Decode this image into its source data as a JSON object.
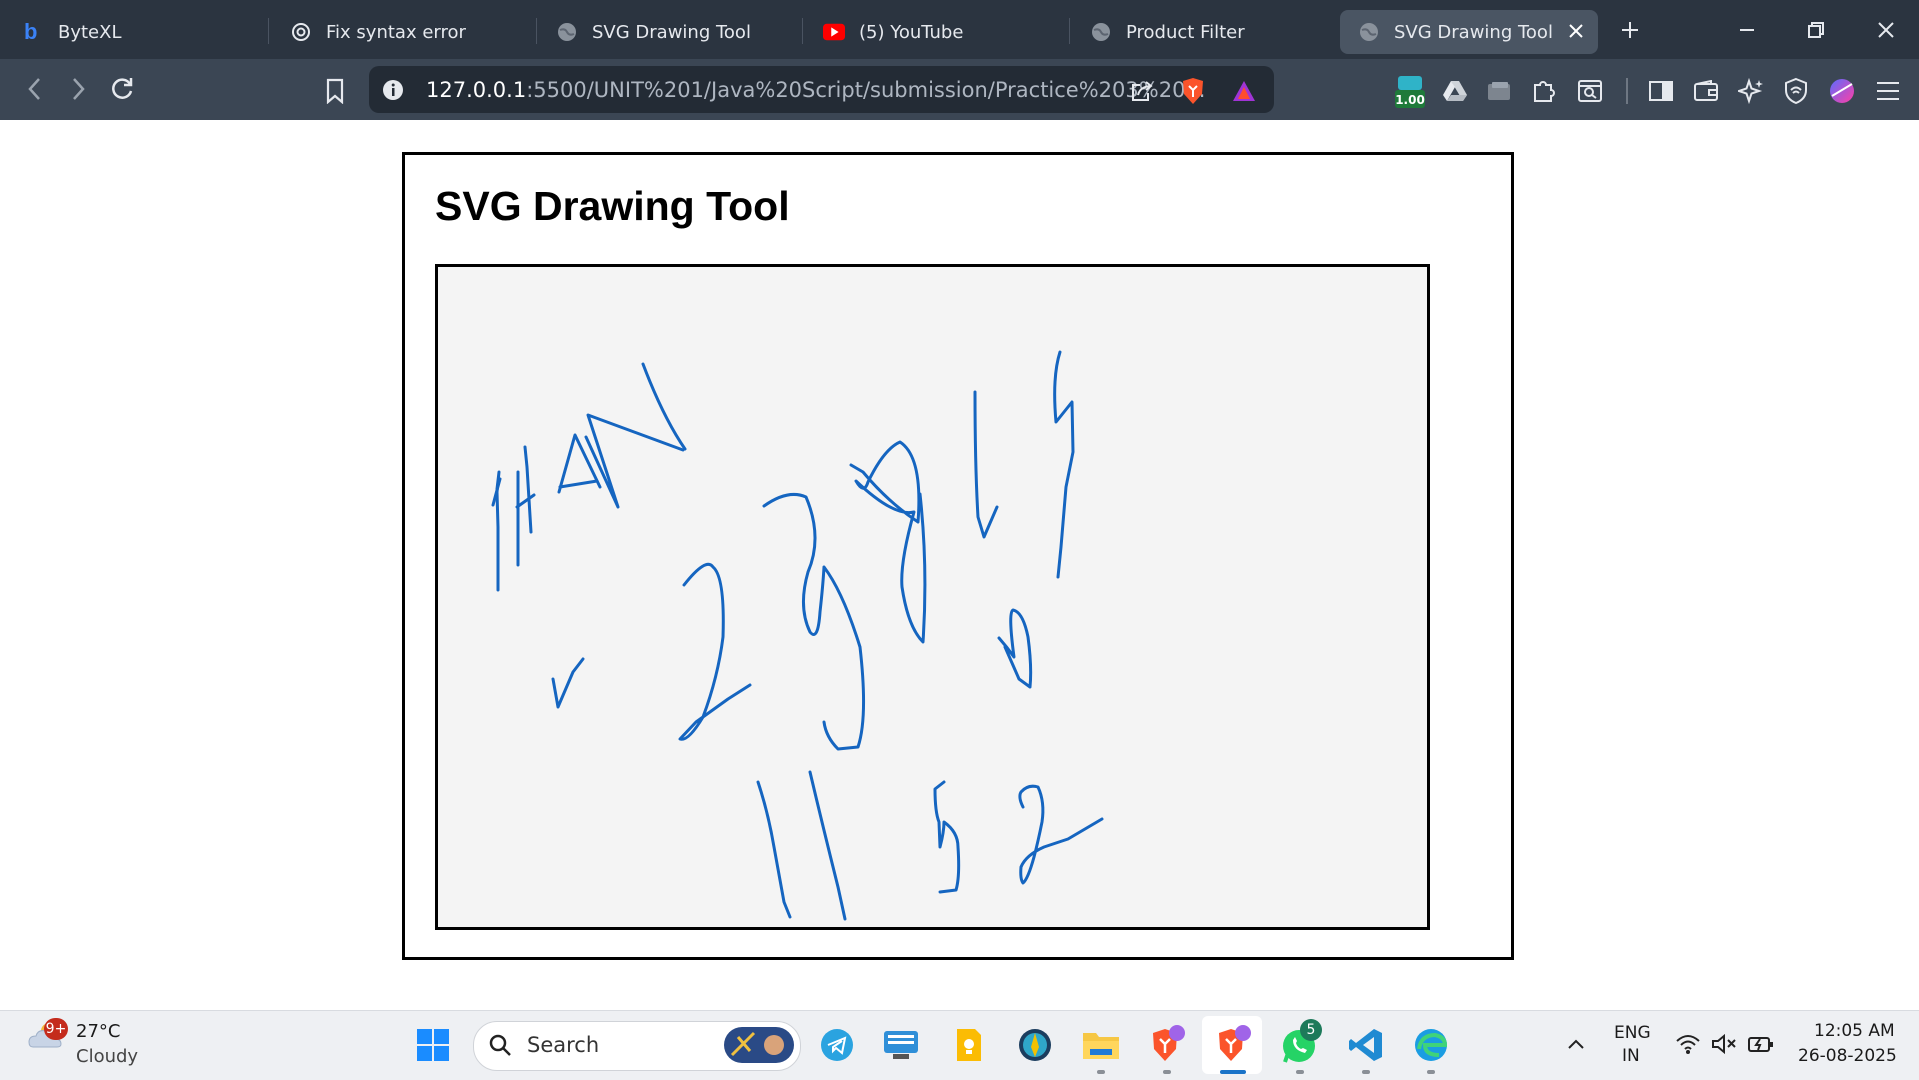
{
  "browser": {
    "tabs": [
      {
        "label": "ByteXL",
        "icon": "bytexl-icon"
      },
      {
        "label": "Fix syntax error",
        "icon": "openai-icon"
      },
      {
        "label": "SVG Drawing Tool",
        "icon": "globe-icon"
      },
      {
        "label": "(5) YouTube",
        "icon": "youtube-icon"
      },
      {
        "label": "Product Filter",
        "icon": "globe-icon"
      },
      {
        "label": "SVG Drawing Tool",
        "icon": "globe-icon",
        "active": true
      }
    ],
    "url_host": "127.0.0.1",
    "url_rest": ":5500/UNIT%201/Java%20Script/submission/Practice%203%20...",
    "extension_badge": "1.00"
  },
  "page": {
    "title": "SVG Drawing Tool"
  },
  "taskbar": {
    "weather_temp": "27°C",
    "weather_desc": "Cloudy",
    "weather_badge": "9+",
    "search_placeholder": "Search",
    "whatsapp_badge": "5",
    "lang_top": "ENG",
    "lang_bottom": "IN",
    "time": "12:05 AM",
    "date": "26-08-2025"
  },
  "colors": {
    "stroke": "#1565c0",
    "tabbar": "#2b3440",
    "toolbar": "#3b4654",
    "canvas_bg": "#f4f4f4"
  }
}
